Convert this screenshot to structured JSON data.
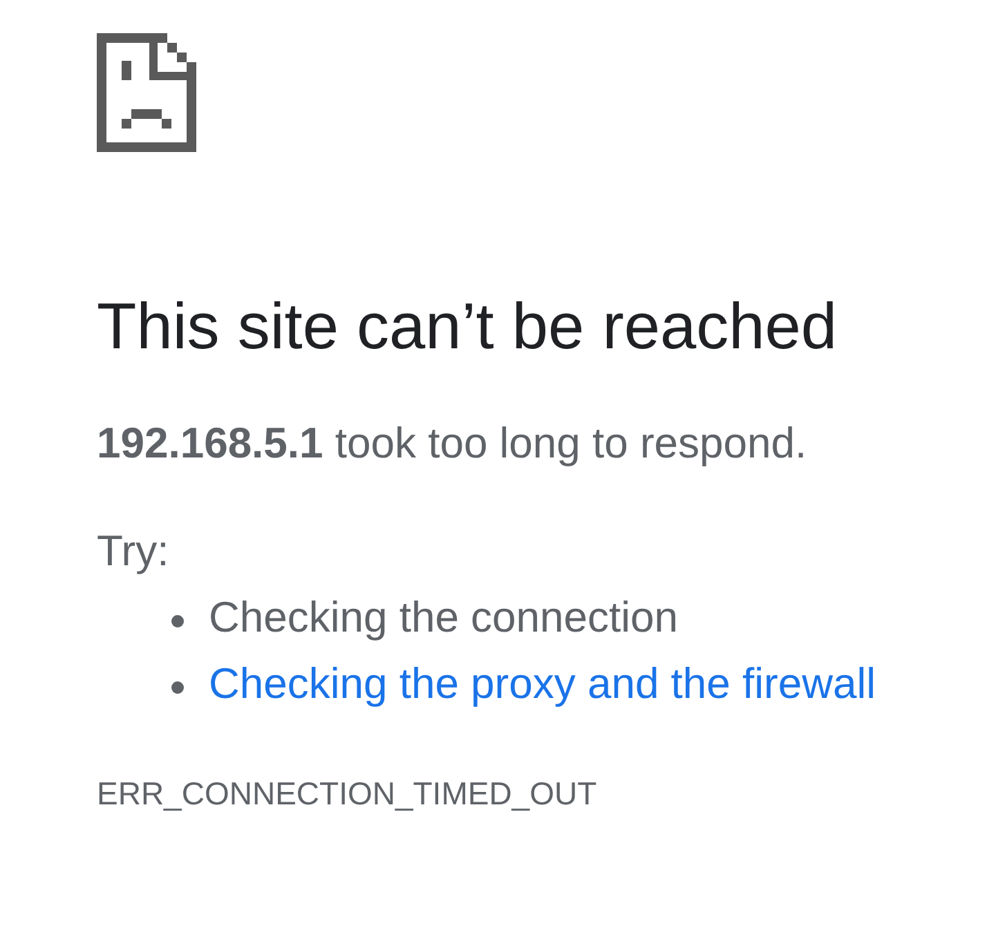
{
  "title": "This site can’t be reached",
  "message": "**192.168.5.1** took too long to respond.",
  "suggestions": {
    "heading": "Try:",
    "items": [
      {
        "kind": "text",
        "text": "Checking the connection"
      },
      {
        "kind": "link",
        "text": "Checking the proxy and the firewall"
      }
    ]
  },
  "error_code": "ERR_CONNECTION_TIMED_OUT"
}
